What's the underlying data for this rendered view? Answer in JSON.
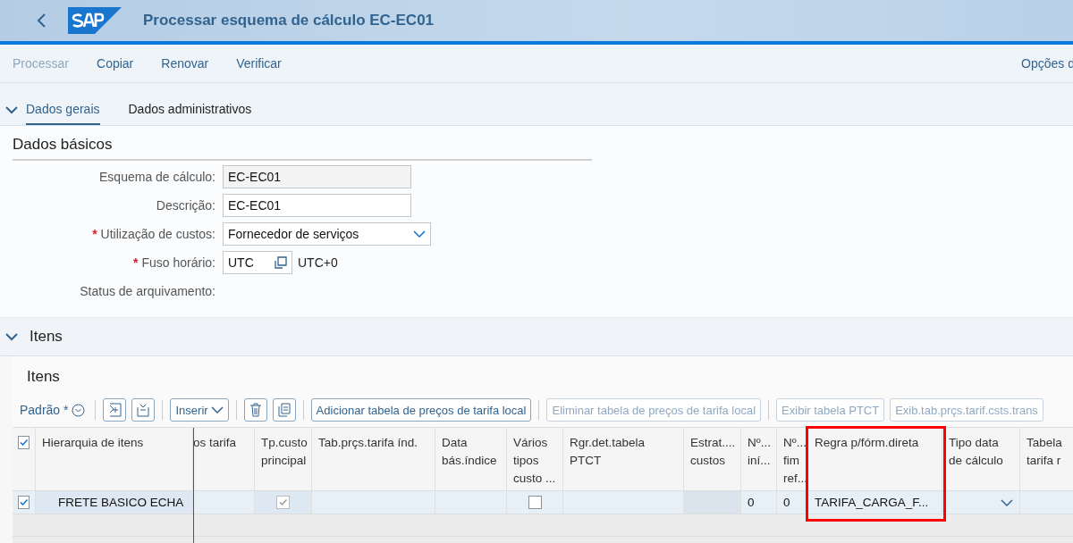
{
  "header": {
    "title": "Processar esquema de cálculo EC-EC01"
  },
  "toolbar": [
    {
      "label": "Processar",
      "disabled": true
    },
    {
      "label": "Copiar",
      "disabled": false
    },
    {
      "label": "Renovar",
      "disabled": false
    },
    {
      "label": "Verificar",
      "disabled": false
    }
  ],
  "options_button": "Opções d",
  "tabs": [
    {
      "label": "Dados gerais",
      "selected": true
    },
    {
      "label": "Dados administrativos",
      "selected": false
    }
  ],
  "basic_data": {
    "title": "Dados básicos",
    "fields": [
      {
        "kind": "readonly",
        "label": "Esquema de cálculo:",
        "value": "EC-EC01"
      },
      {
        "kind": "input",
        "label": "Descrição:",
        "value": "EC-EC01"
      },
      {
        "kind": "select",
        "label": "Utilização de custos:",
        "marker": "*",
        "value": "Fornecedor de serviços"
      },
      {
        "kind": "valuehelp",
        "label": "Fuso horário:",
        "marker": "*",
        "value": "UTC",
        "extra": "UTC+0"
      },
      {
        "kind": "empty",
        "label": "Status de arquivamento:"
      }
    ]
  },
  "items": {
    "title": "Itens",
    "expanded": true,
    "subtitle": "Itens",
    "variant": "Padrão *",
    "tools": [
      {
        "kind": "expand",
        "disabled": false
      },
      {
        "kind": "collapse",
        "disabled": false
      },
      {
        "kind": "menu",
        "label": "Inserir",
        "disabled": false
      },
      {
        "kind": "delete",
        "disabled": false
      },
      {
        "kind": "copy",
        "disabled": false
      },
      {
        "kind": "text",
        "label": "Adicionar tabela de preços de tarifa local",
        "disabled": false
      },
      {
        "kind": "text",
        "label": "Eliminar tabela de preços de tarifa local",
        "disabled": true
      },
      {
        "kind": "text",
        "label": "Exibir tabela PTCT",
        "disabled": true
      },
      {
        "kind": "text",
        "label": "Exib.tab.prçs.tarif.csts.trans",
        "disabled": true
      }
    ],
    "all_selected": true,
    "columns": [
      {
        "label": "Hierarquia de itens",
        "highlighted": false
      },
      {
        "label": "os tarifa",
        "highlighted": false
      },
      {
        "label": "Tp.custo principal",
        "highlighted": false
      },
      {
        "label": "Tab.prçs.tarifa índ.",
        "highlighted": false
      },
      {
        "label": "Data bás.índice",
        "highlighted": false
      },
      {
        "label": "Vários tipos custo ...",
        "highlighted": false
      },
      {
        "label": "Rgr.det.tabela PTCT",
        "highlighted": false
      },
      {
        "label": "Estrat.... custos",
        "highlighted": false
      },
      {
        "label": "Nº... iní...",
        "highlighted": false
      },
      {
        "label": "Nº... fim ref...",
        "highlighted": false
      },
      {
        "label": "Regra p/fórm.direta",
        "highlighted": true
      },
      {
        "label": "Tipo data de cálculo",
        "highlighted": false
      },
      {
        "label": "Tabela tarifa r",
        "highlighted": false
      }
    ],
    "rows": [
      {
        "selected": true,
        "cells": [
          {
            "kind": "text",
            "value": "FRETE BASICO ECHA"
          },
          {
            "kind": "empty"
          },
          {
            "kind": "checkbox",
            "checked": true,
            "disabled": true
          },
          {
            "kind": "empty"
          },
          {
            "kind": "empty"
          },
          {
            "kind": "checkbox",
            "checked": false,
            "disabled": false
          },
          {
            "kind": "empty"
          },
          {
            "kind": "readonly"
          },
          {
            "kind": "text",
            "value": "0"
          },
          {
            "kind": "text",
            "value": "0"
          },
          {
            "kind": "text",
            "value": "TARIFA_CARGA_F..."
          },
          {
            "kind": "dropdown"
          },
          {
            "kind": "empty"
          }
        ]
      }
    ]
  }
}
